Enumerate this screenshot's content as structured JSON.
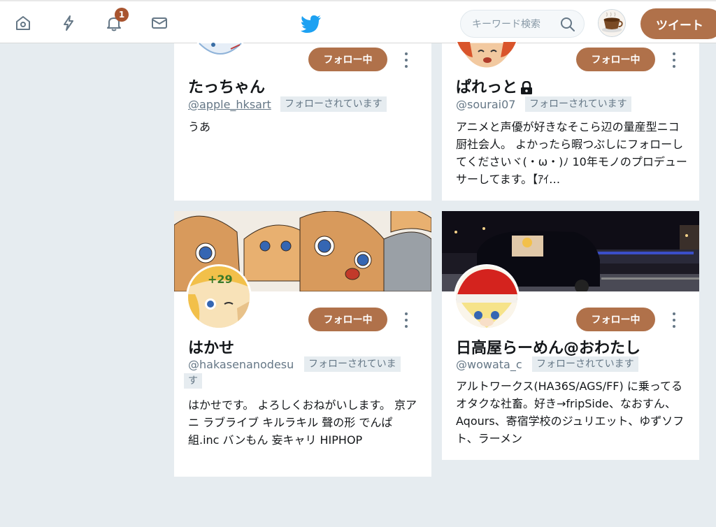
{
  "nav": {
    "notifications_count": "1",
    "search_placeholder": "キーワード検索",
    "tweet_label": "ツイート"
  },
  "cards": [
    {
      "name": "たっちゃん",
      "handle": "@apple_hksart",
      "follows_you": "フォローされています",
      "bio": "うあ",
      "follow_label": "フォロー中"
    },
    {
      "name": "ぱれっと",
      "handle": "@sourai07",
      "follows_you": "フォローされています",
      "bio": "アニメと声優が好きなそこら辺の量産型ニコ厨社会人。 よかったら暇つぶしにフォローしてくださいヾ(・ω・)ﾉ 10年モノのプロデューサーしてます。【ｱｲ…",
      "follow_label": "フォロー中",
      "protected": true
    },
    {
      "name": "はかせ",
      "handle": "@hakasenanodesu",
      "follows_you_line1": "フォローされていま",
      "follows_you_line2": "す",
      "bio": "はかせです。 よろしくおねがいします。 京アニ ラブライブ キルラキル 聲の形 でんぱ組.inc バンもん 妄キャリ HIPHOP",
      "follow_label": "フォロー中"
    },
    {
      "name": "日高屋らーめん@おわたし",
      "handle": "@wowata_c",
      "follows_you": "フォローされています",
      "bio": "アルトワークス(HA36S/AGS/FF) に乗ってるオタクな社畜。好き→fripSide、なおすん、Aqours、寄宿学校のジュリエット、ゆずソフト、ラーメン",
      "follow_label": "フォロー中"
    }
  ],
  "colors": {
    "accent": "#b0714a",
    "badge": "#a8542f",
    "twitter_blue": "#1da1f2",
    "background": "#e6ecf0"
  }
}
